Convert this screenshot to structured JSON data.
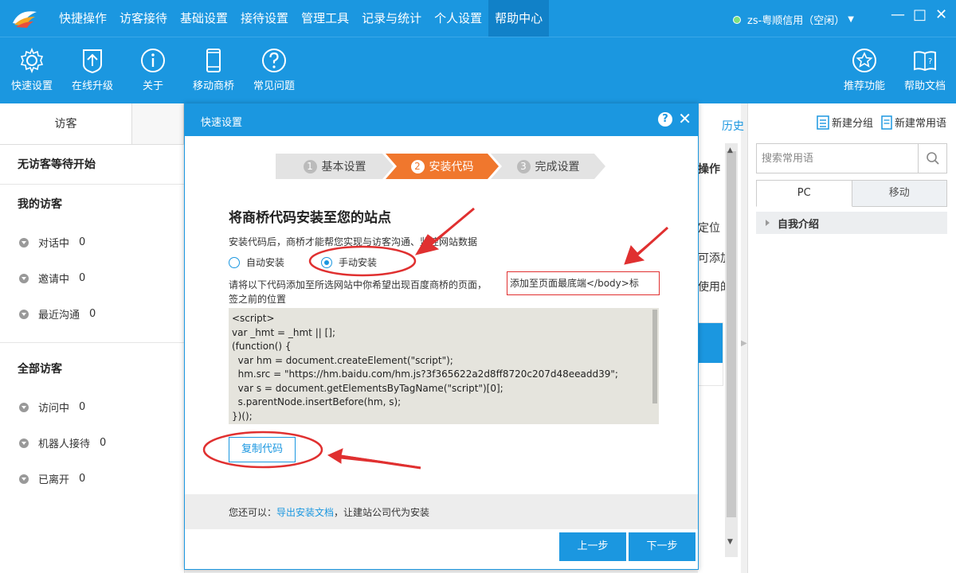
{
  "menu": {
    "items": [
      "快捷操作",
      "访客接待",
      "基础设置",
      "接待设置",
      "管理工具",
      "记录与统计",
      "个人设置",
      "帮助中心"
    ],
    "active": "帮助中心",
    "status": "zs-粤顺信用（空闲）",
    "status_color": "#7ee07e",
    "brand_color": "#1b97e0"
  },
  "toolbar": {
    "left": [
      {
        "label": "快速设置",
        "icon": "gear-icon"
      },
      {
        "label": "在线升级",
        "icon": "upgrade-icon"
      },
      {
        "label": "关于",
        "icon": "info-icon"
      },
      {
        "label": "移动商桥",
        "icon": "phone-icon"
      },
      {
        "label": "常见问题",
        "icon": "question-icon"
      }
    ],
    "right": [
      {
        "label": "推荐功能",
        "icon": "star-icon"
      },
      {
        "label": "帮助文档",
        "icon": "book-icon"
      }
    ]
  },
  "left_panel": {
    "tabs": [
      "访客",
      ""
    ],
    "waiting": "无访客等待开始",
    "my_visitors": {
      "title": "我的访客",
      "items": [
        {
          "label": "对话中",
          "count": "0"
        },
        {
          "label": "邀请中",
          "count": "0"
        },
        {
          "label": "最近沟通",
          "count": "0"
        }
      ]
    },
    "all_visitors": {
      "title": "全部访客",
      "items": [
        {
          "label": "访问中",
          "count": "0"
        },
        {
          "label": "机器人接待",
          "count": "0"
        },
        {
          "label": "已离开",
          "count": "0"
        }
      ]
    }
  },
  "middle_panel": {
    "texts": [
      "历史",
      "操作",
      "定位",
      "可添加",
      "使用的"
    ]
  },
  "right_panel": {
    "new_group": "新建分组",
    "new_phrase": "新建常用语",
    "search_placeholder": "搜索常用语",
    "tabs": [
      "PC",
      "移动"
    ],
    "group": "自我介绍"
  },
  "dialog": {
    "title": "快速设置",
    "help": "?",
    "close": "✕",
    "steps": [
      {
        "num": "1",
        "label": "基本设置"
      },
      {
        "num": "2",
        "label": "安装代码"
      },
      {
        "num": "3",
        "label": "完成设置"
      }
    ],
    "active_step": 2,
    "active_step_color": "#f0772d",
    "heading": "将商桥代码安装至您的站点",
    "desc": "安装代码后，商桥才能帮您实现与访客沟通、监控网站数据",
    "radio_auto": "自动安装",
    "radio_manual": "手动安装",
    "selected_radio": "手动安装",
    "instruction_prefix": "请将以下代码添加至所选网站中你希望出现百度商桥的页面，",
    "instruction_highlight": "添加至页面最底端</body>标",
    "instruction_suffix": "签之前的位置",
    "code": "<script>\nvar _hmt = _hmt || [];\n(function() {\n  var hm = document.createElement(\"script\");\n  hm.src = \"https://hm.baidu.com/hm.js?3f365622a2d8ff8720c207d48eeadd39\";\n  var s = document.getElementsByTagName(\"script\")[0];\n  s.parentNode.insertBefore(hm, s);\n})();",
    "copy_button": "复制代码",
    "footer_prefix": "您还可以：",
    "footer_link": "导出安装文档",
    "footer_suffix": "，让建站公司代为安装",
    "prev_button": "上一步",
    "next_button": "下一步"
  },
  "annotation_color": "#e03030"
}
